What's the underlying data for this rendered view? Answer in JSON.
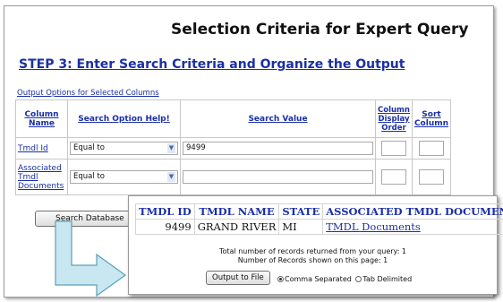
{
  "form": {
    "title": "Selection Criteria for Expert Query",
    "step_heading": "STEP 3: Enter Search Criteria and Organize the Output",
    "output_options_link": "Output Options for Selected Columns",
    "headers": {
      "column_name": "Column Name",
      "search_option": "Search Option Help!",
      "search_value": "Search Value",
      "display_order": "Column Display Order",
      "sort_column": "Sort Column"
    },
    "rows": [
      {
        "name": "Tmdl Id",
        "option": "Equal to",
        "value": "9499",
        "display_order": "",
        "sort": ""
      },
      {
        "name": "Associated Tmdl Documents",
        "option": "Equal to",
        "value": "",
        "display_order": "",
        "sort": ""
      }
    ],
    "search_button": "Search Database"
  },
  "results": {
    "columns": [
      "TMDL ID",
      "TMDL NAME",
      "STATE",
      "ASSOCIATED TMDL DOCUMENTS"
    ],
    "rows": [
      {
        "id": "9499",
        "name": "GRAND RIVER",
        "state": "MI",
        "documents": "TMDL Documents"
      }
    ],
    "total_records": "Total number of records returned from your query: 1",
    "shown_records": "Number of Records shown on this page: 1",
    "output_button": "Output to File",
    "format_options": [
      {
        "label": "Comma Separated",
        "selected": true
      },
      {
        "label": "Tab Delimited",
        "selected": false
      }
    ]
  },
  "icons": {
    "dropdown": "chevron-down-icon",
    "arrow": "flow-arrow-icon"
  },
  "colors": {
    "link": "#1a2fa8",
    "arrow_fill": "#c9e7f1",
    "arrow_stroke": "#5a9fb8"
  }
}
